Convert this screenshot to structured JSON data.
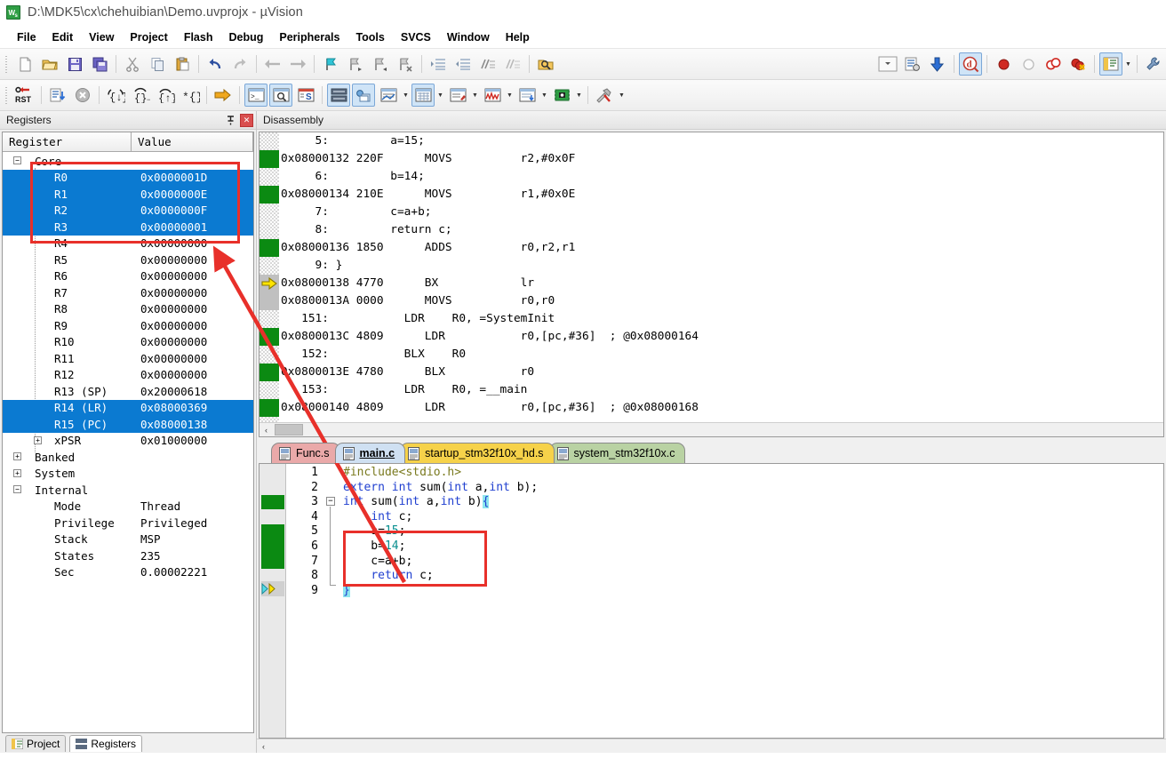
{
  "window": {
    "title": "D:\\MDK5\\cx\\chehuibian\\Demo.uvprojx - µVision",
    "logo_text": "µV"
  },
  "menu": {
    "items": [
      {
        "label": "File"
      },
      {
        "label": "Edit"
      },
      {
        "label": "View"
      },
      {
        "label": "Project"
      },
      {
        "label": "Flash"
      },
      {
        "label": "Debug"
      },
      {
        "label": "Peripherals"
      },
      {
        "label": "Tools"
      },
      {
        "label": "SVCS"
      },
      {
        "label": "Window"
      },
      {
        "label": "Help"
      }
    ]
  },
  "toolbar_main": {
    "icons": [
      "new-file-icon",
      "open-file-icon",
      "save-icon",
      "save-all-icon",
      "cut-icon",
      "copy-icon",
      "paste-icon",
      "undo-icon",
      "redo-icon",
      "navigate-back-icon",
      "navigate-forward-icon",
      "bookmark-toggle-icon",
      "bookmark-next-icon",
      "bookmark-prev-icon",
      "bookmark-clear-icon",
      "indent-icon",
      "outdent-icon",
      "comment-icon",
      "uncomment-icon",
      "find-in-files-icon",
      "target-dropdown-icon",
      "target-options-icon",
      "batch-build-icon",
      "start-debug-icon",
      "insert-breakpoint-icon",
      "disable-breakpoint-icon",
      "disable-all-breakpoints-icon",
      "kill-all-breakpoints-icon",
      "project-window-icon",
      "project-window-dropdown-icon",
      "configure-icon"
    ]
  },
  "toolbar_debug": {
    "icons": [
      "reset-cpu-icon",
      "run-icon",
      "stop-icon",
      "step-into-icon",
      "step-over-icon",
      "step-out-icon",
      "run-to-cursor-icon",
      "show-next-statement-icon",
      "command-window-icon",
      "disassembly-window-icon",
      "symbols-window-icon",
      "registers-window-icon",
      "call-stack-window-icon",
      "watch-window-icon",
      "memory-window-icon",
      "serial-window-icon",
      "analysis-window-icon",
      "trace-window-icon",
      "system-viewer-icon",
      "toolbox-icon"
    ]
  },
  "registers_panel": {
    "title": "Registers",
    "pin_icon": "pin-icon",
    "close_icon": "close-icon",
    "columns": [
      "Register",
      "Value"
    ],
    "groups": [
      {
        "name": "Core",
        "expander": "collapse-icon",
        "rows": [
          {
            "name": "R0",
            "value": "0x0000001D",
            "selected": true
          },
          {
            "name": "R1",
            "value": "0x0000000E",
            "selected": true
          },
          {
            "name": "R2",
            "value": "0x0000000F",
            "selected": true
          },
          {
            "name": "R3",
            "value": "0x00000001",
            "selected": true
          },
          {
            "name": "R4",
            "value": "0x00000000",
            "selected": false
          },
          {
            "name": "R5",
            "value": "0x00000000",
            "selected": false
          },
          {
            "name": "R6",
            "value": "0x00000000",
            "selected": false
          },
          {
            "name": "R7",
            "value": "0x00000000",
            "selected": false
          },
          {
            "name": "R8",
            "value": "0x00000000",
            "selected": false
          },
          {
            "name": "R9",
            "value": "0x00000000",
            "selected": false
          },
          {
            "name": "R10",
            "value": "0x00000000",
            "selected": false
          },
          {
            "name": "R11",
            "value": "0x00000000",
            "selected": false
          },
          {
            "name": "R12",
            "value": "0x00000000",
            "selected": false
          },
          {
            "name": "R13 (SP)",
            "value": "0x20000618",
            "selected": false
          },
          {
            "name": "R14 (LR)",
            "value": "0x08000369",
            "selected": true
          },
          {
            "name": "R15 (PC)",
            "value": "0x08000138",
            "selected": true
          }
        ],
        "subgroup": {
          "name": "xPSR",
          "value": "0x01000000",
          "expander": "expand-icon"
        }
      },
      {
        "name": "Banked",
        "expander": "expand-icon",
        "rows": []
      },
      {
        "name": "System",
        "expander": "expand-icon",
        "rows": []
      },
      {
        "name": "Internal",
        "expander": "collapse-icon",
        "rows": [
          {
            "name": "Mode",
            "value": "Thread",
            "selected": false
          },
          {
            "name": "Privilege",
            "value": "Privileged",
            "selected": false
          },
          {
            "name": "Stack",
            "value": "MSP",
            "selected": false
          },
          {
            "name": "States",
            "value": "235",
            "selected": false
          },
          {
            "name": "Sec",
            "value": "0.00002221",
            "selected": false
          }
        ]
      }
    ],
    "bottom_tabs": [
      {
        "label": "Project",
        "icon": "project-icon",
        "active": false
      },
      {
        "label": "Registers",
        "icon": "registers-icon",
        "active": true
      }
    ]
  },
  "disassembly_panel": {
    "title": "Disassembly",
    "lines": [
      {
        "kind": "source",
        "text": "     5:         a=15;"
      },
      {
        "kind": "asm",
        "marker": "covered",
        "text": "0x08000132 220F      MOVS          r2,#0x0F"
      },
      {
        "kind": "source",
        "text": "     6:         b=14;"
      },
      {
        "kind": "asm",
        "marker": "covered",
        "text": "0x08000134 210E      MOVS          r1,#0x0E"
      },
      {
        "kind": "source",
        "text": "     7:         c=a+b;"
      },
      {
        "kind": "source",
        "text": "     8:         return c;"
      },
      {
        "kind": "asm",
        "marker": "covered",
        "text": "0x08000136 1850      ADDS          r0,r2,r1"
      },
      {
        "kind": "source",
        "text": "     9: }"
      },
      {
        "kind": "asm",
        "marker": "pc",
        "text": "0x08000138 4770      BX            lr"
      },
      {
        "kind": "asm",
        "marker": "pcline",
        "text": "0x0800013A 0000      MOVS          r0,r0"
      },
      {
        "kind": "source",
        "text": "   151:           LDR    R0, =SystemInit"
      },
      {
        "kind": "asm",
        "marker": "covered",
        "text": "0x0800013C 4809      LDR           r0,[pc,#36]  ; @0x08000164"
      },
      {
        "kind": "source",
        "text": "   152:           BLX    R0"
      },
      {
        "kind": "asm",
        "marker": "covered",
        "text": "0x0800013E 4780      BLX           r0"
      },
      {
        "kind": "source",
        "text": "   153:           LDR    R0, =__main"
      },
      {
        "kind": "asm",
        "marker": "covered",
        "text": "0x08000140 4809      LDR           r0,[pc,#36]  ; @0x08000168"
      }
    ],
    "scroll_left_icon": "scroll-left-icon"
  },
  "editor_tabs": [
    {
      "label": "Func.s",
      "icon": "file-icon",
      "active": false,
      "color": "#eaa9a9"
    },
    {
      "label": "main.c",
      "icon": "file-icon",
      "active": true,
      "color": "#cfe0f2"
    },
    {
      "label": "startup_stm32f10x_hd.s",
      "icon": "file-icon",
      "active": false,
      "color": "#f6d24a"
    },
    {
      "label": "system_stm32f10x.c",
      "icon": "file-icon",
      "active": false,
      "color": "#b9d2a3"
    }
  ],
  "editor": {
    "filename": "main.c",
    "line_numbers": [
      "1",
      "2",
      "3",
      "4",
      "5",
      "6",
      "7",
      "8",
      "9"
    ],
    "lines": [
      "#include<stdio.h>",
      "extern int sum(int a,int b);",
      "int sum(int a,int b){",
      "    int c;",
      "    a=15;",
      "    b=14;",
      "    c=a+b;",
      "    return c;",
      "}"
    ],
    "next_statement_marker": "next-statement-arrow-icon",
    "fold_marker": "code-fold-icon"
  },
  "annotations": {
    "rect_registers_label": "highlighted-registers-box",
    "rect_code_label": "highlighted-code-box",
    "arrow_label": "annotation-arrow",
    "color": "#e8302a"
  },
  "colors": {
    "selection_blue": "#0b7ad1",
    "coverage_green": "#0b8a12",
    "pc_arrow_yellow": "#ffe400",
    "annotation_red": "#e8302a",
    "source_line_red": "#9b2020",
    "keyword_blue": "#1f3fd0",
    "number_teal": "#0a8f8f"
  }
}
